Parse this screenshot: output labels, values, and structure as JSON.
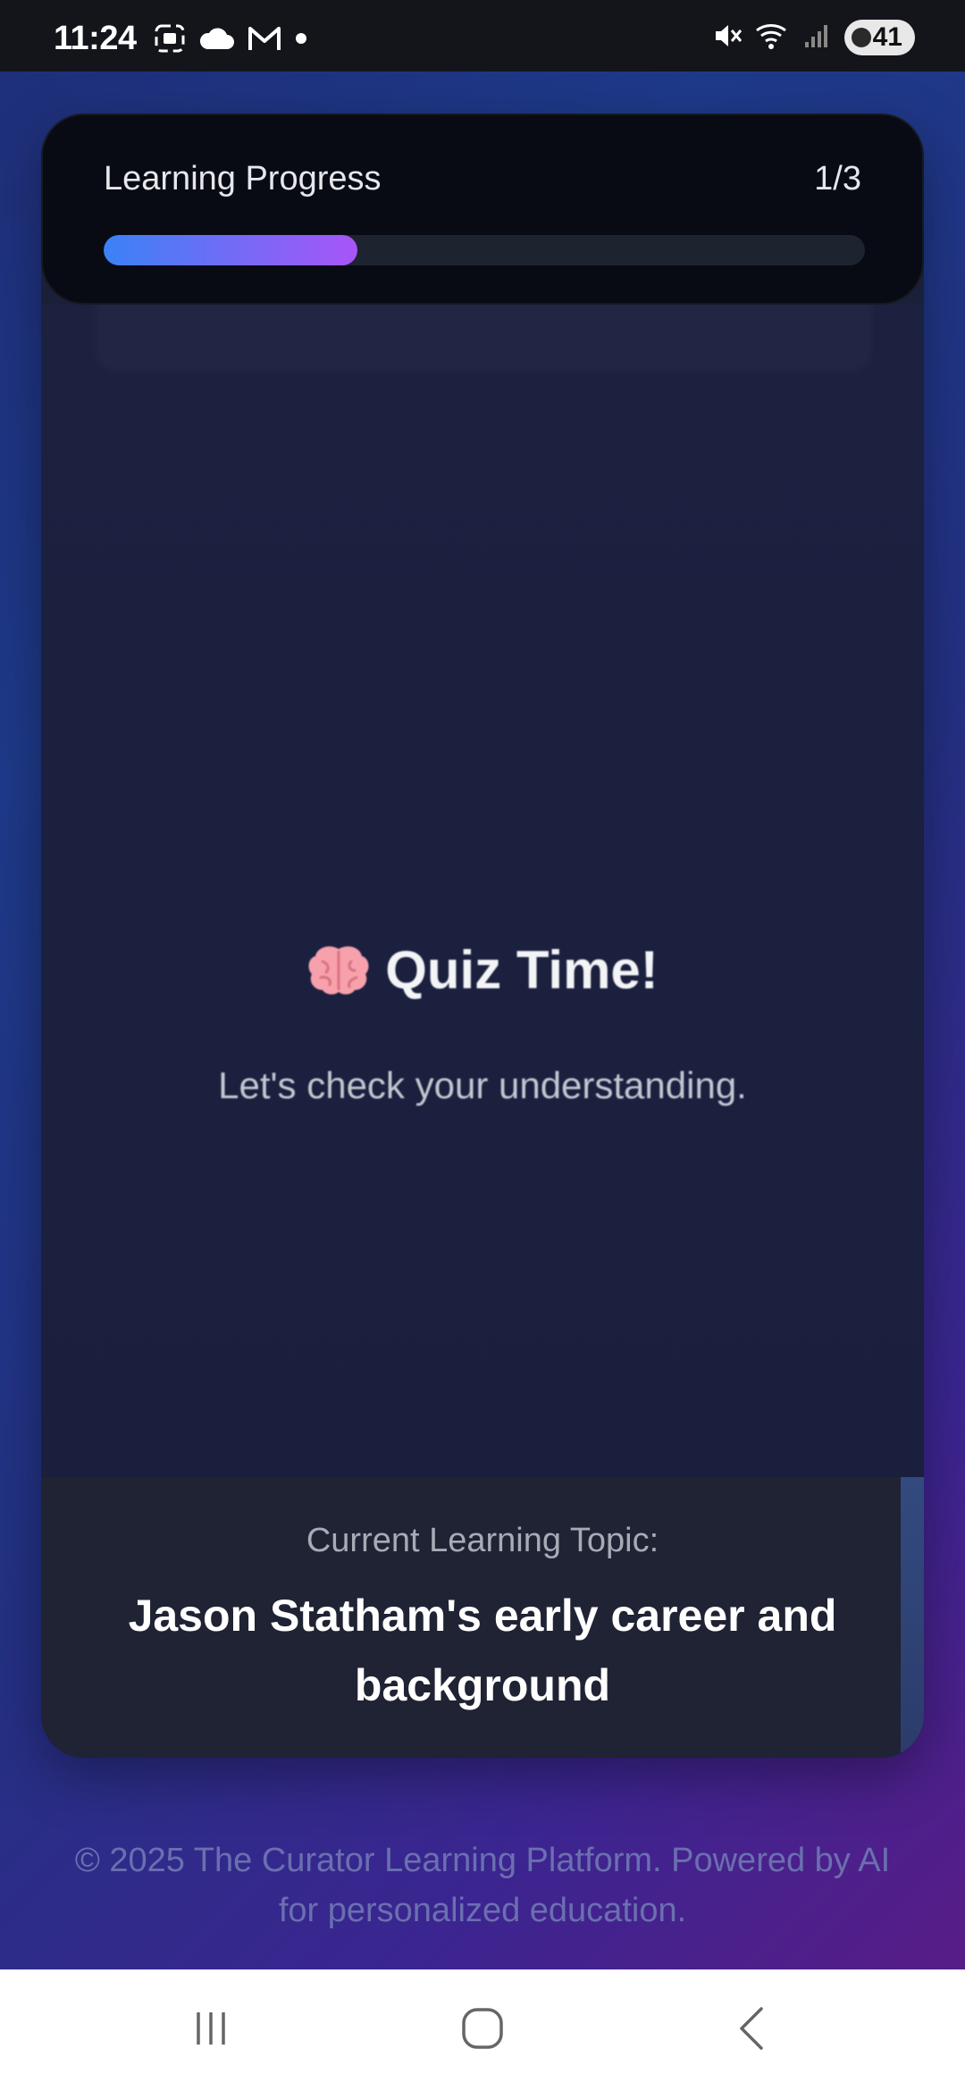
{
  "status_bar": {
    "time": "11:24",
    "battery": "41",
    "icons": [
      "screen-capture-icon",
      "cloud-icon",
      "gmail-icon",
      "dot-icon",
      "mute-icon",
      "wifi-icon",
      "signal-icon",
      "battery-icon"
    ]
  },
  "progress": {
    "label": "Learning Progress",
    "count": "1/3",
    "fraction": 0.333
  },
  "quiz": {
    "emoji_icon": "brain-icon",
    "title": "Quiz Time!",
    "subtitle": "Let's check your understanding."
  },
  "topic": {
    "label": "Current Learning Topic:",
    "title": "Jason Statham's early career and background"
  },
  "footer": {
    "text": "© 2025 The Curator Learning Platform. Powered by AI for personalized education."
  },
  "nav": {
    "buttons": [
      "recent-apps-icon",
      "home-icon",
      "back-icon"
    ]
  },
  "colors": {
    "progress_start": "#3b82f6",
    "progress_end": "#a855f7",
    "card_bg": "#1b2039"
  }
}
